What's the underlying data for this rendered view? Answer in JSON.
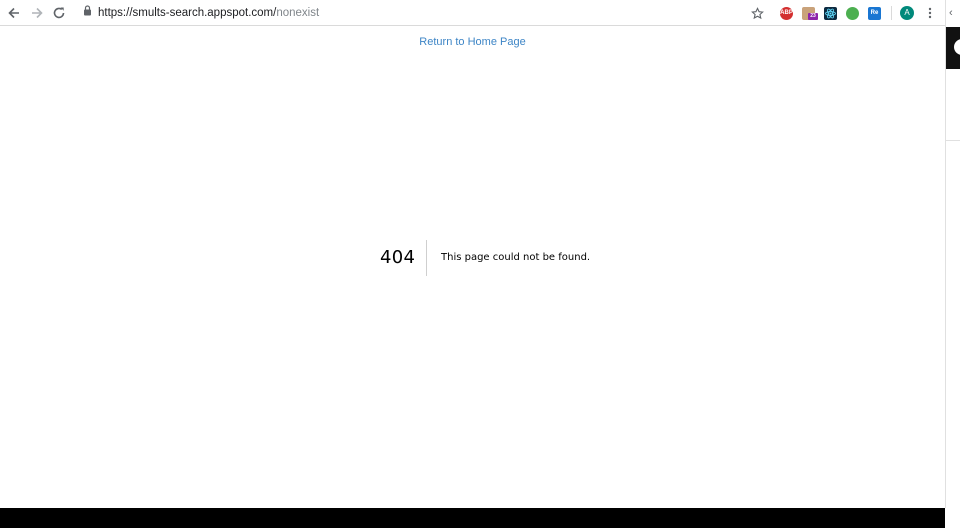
{
  "browser": {
    "url_host": "https://smults-search.appspot.com/",
    "url_path": "nonexist",
    "avatar_letter": "A",
    "extensions": [
      {
        "label": "ABP",
        "color": "#d32f2f"
      },
      {
        "label": "23",
        "color": "#8e24aa"
      },
      {
        "label": "",
        "color": "#0d2a40"
      },
      {
        "label": "",
        "color": "#4caf50"
      },
      {
        "label": "Re",
        "color": "#1976d2"
      }
    ]
  },
  "page": {
    "home_link": "Return to Home Page",
    "error_code": "404",
    "error_message": "This page could not be found."
  },
  "colors": {
    "link": "#3d85c6",
    "avatar": "#00897b"
  }
}
